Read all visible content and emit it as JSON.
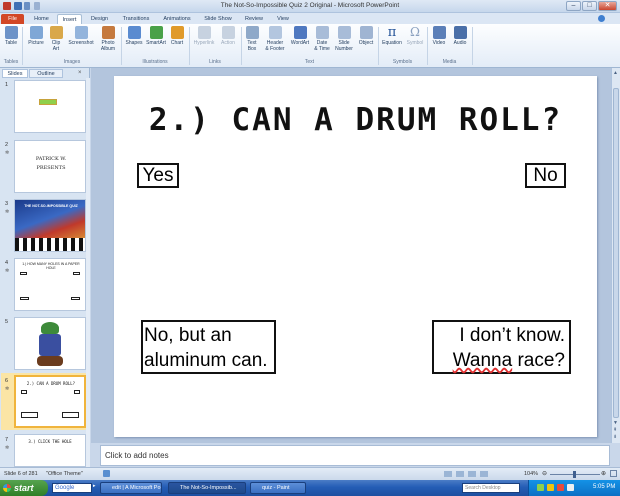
{
  "window": {
    "title": "The Not-So-Impossible Quiz 2 Original  -  Microsoft PowerPoint"
  },
  "ribbon": {
    "tabs": [
      "File",
      "Home",
      "Insert",
      "Design",
      "Transitions",
      "Animations",
      "Slide Show",
      "Review",
      "View"
    ],
    "active_tab": "Insert",
    "buttons": [
      {
        "label": "Table",
        "sub": "",
        "icon": "table-icon"
      },
      {
        "label": "Picture",
        "sub": "",
        "icon": "picture-icon"
      },
      {
        "label": "Clip",
        "sub": "Art",
        "icon": "clip-art-icon"
      },
      {
        "label": "Screenshot",
        "sub": "",
        "icon": "screenshot-icon"
      },
      {
        "label": "Photo",
        "sub": "Album",
        "icon": "photo-album-icon"
      },
      {
        "label": "Shapes",
        "sub": "",
        "icon": "shapes-icon"
      },
      {
        "label": "SmartArt",
        "sub": "",
        "icon": "smartart-icon"
      },
      {
        "label": "Chart",
        "sub": "",
        "icon": "chart-icon"
      },
      {
        "label": "Hyperlink",
        "sub": "",
        "icon": "hyperlink-icon"
      },
      {
        "label": "Action",
        "sub": "",
        "icon": "action-icon"
      },
      {
        "label": "Text",
        "sub": "Box",
        "icon": "text-box-icon"
      },
      {
        "label": "Header",
        "sub": "& Footer",
        "icon": "header-footer-icon"
      },
      {
        "label": "WordArt",
        "sub": "",
        "icon": "wordart-icon"
      },
      {
        "label": "Date",
        "sub": "& Time",
        "icon": "date-time-icon"
      },
      {
        "label": "Slide",
        "sub": "Number",
        "icon": "slide-number-icon"
      },
      {
        "label": "Object",
        "sub": "",
        "icon": "object-icon"
      },
      {
        "label": "Equation",
        "sub": "",
        "icon": "equation-icon"
      },
      {
        "label": "Symbol",
        "sub": "",
        "icon": "symbol-icon"
      },
      {
        "label": "Video",
        "sub": "",
        "icon": "video-icon"
      },
      {
        "label": "Audio",
        "sub": "",
        "icon": "audio-icon"
      }
    ],
    "groups": [
      "Tables",
      "Images",
      "Illustrations",
      "Links",
      "Text",
      "Symbols",
      "Media"
    ]
  },
  "left_pane": {
    "tabs": [
      "Slides",
      "Outline"
    ],
    "thumbs": [
      {
        "num": "1",
        "text": ""
      },
      {
        "num": "2",
        "text": "PATRICK W.\nPRESENTS"
      },
      {
        "num": "3",
        "text": "THE NOT-SO-IMPOSSIBLE QUIZ"
      },
      {
        "num": "4",
        "text": "1.) HOW MANY HOLES IN A PAPER HOLE"
      },
      {
        "num": "5",
        "text": ""
      },
      {
        "num": "6",
        "text": "2.) CAN A DRUM ROLL?"
      },
      {
        "num": "7",
        "text": "3.) CLICK THE HOLE"
      }
    ]
  },
  "slide": {
    "title": "2.) CAN A DRUM ROLL?",
    "answers": {
      "top_left": "Yes",
      "top_right": "No",
      "bottom_left_1": "No, but an",
      "bottom_left_2": "aluminum can.",
      "bottom_right_1": "I don’t know.",
      "bottom_right_2a": "Wanna",
      "bottom_right_2b": " race?"
    }
  },
  "notes": {
    "placeholder": "Click to add notes"
  },
  "status": {
    "slide": "Slide 6 of 281",
    "theme": "\"Office Theme\"",
    "zoom": "104%"
  },
  "taskbar": {
    "start": "start",
    "search": "Google",
    "items": [
      "edit | A Microsoft Po...",
      "The Not-So-Impossib...",
      "quiz - Paint"
    ],
    "search_placeholder": "Search Desktop",
    "time": "5:05 PM"
  },
  "colors": {
    "file_tab": "#d24726",
    "selection": "#f0b43c",
    "taskbar": "#245db5"
  }
}
